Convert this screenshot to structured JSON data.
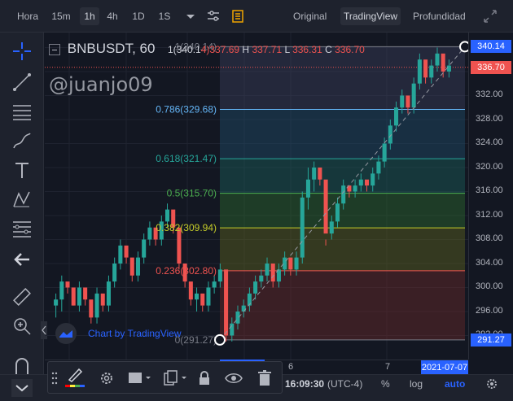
{
  "toolbar": {
    "timeframes": [
      {
        "label": "Hora",
        "active": false
      },
      {
        "label": "15m",
        "active": false
      },
      {
        "label": "1h",
        "active": true
      },
      {
        "label": "4h",
        "active": false
      },
      {
        "label": "1D",
        "active": false
      },
      {
        "label": "1S",
        "active": false
      }
    ],
    "chart_modes": [
      {
        "label": "Original",
        "active": false
      },
      {
        "label": "TradingView",
        "active": true
      },
      {
        "label": "Profundidad",
        "active": false
      }
    ],
    "icons": [
      "chevron-down-icon",
      "indicators-icon",
      "notes-icon",
      "fullscreen-icon"
    ]
  },
  "legend": {
    "symbol": "BNBUSDT, 60",
    "open_label": "1(340.1",
    "open_value": "4)",
    "open_extra": "337.69",
    "high_label": "H",
    "high_value": "337.71",
    "low_label": "L",
    "low_value": "336.31",
    "close_label": "C",
    "close_value": "336.70"
  },
  "watermark": "@juanjo09",
  "branding": "Chart by TradingView",
  "fib_levels": [
    {
      "label": "1(340.14)",
      "ratio": 1,
      "price": 340.14,
      "color": "#787b86"
    },
    {
      "label": "0.786(329.68)",
      "ratio": 0.786,
      "price": 329.68,
      "color": "#64b5f6"
    },
    {
      "label": "0.618(321.47)",
      "ratio": 0.618,
      "price": 321.47,
      "color": "#26a69a"
    },
    {
      "label": "0.5(315.70)",
      "ratio": 0.5,
      "price": 315.7,
      "color": "#4caf50"
    },
    {
      "label": "0.382(309.94)",
      "ratio": 0.382,
      "price": 309.94,
      "color": "#c5cc29"
    },
    {
      "label": "0.236(302.80)",
      "ratio": 0.236,
      "price": 302.8,
      "color": "#ef5350"
    },
    {
      "label": "0(291.27)",
      "ratio": 0,
      "price": 291.27,
      "color": "#787b86"
    }
  ],
  "price_axis": {
    "ticks": [
      "332.00",
      "328.00",
      "324.00",
      "320.00",
      "316.00",
      "312.00",
      "308.00",
      "304.00",
      "300.00",
      "296.00",
      "292.00"
    ],
    "top_badge": "340.14",
    "current_badge": "336.70",
    "bottom_badge": "291.27",
    "badge_color": "#2962ff",
    "current_color": "#ef5350"
  },
  "time_axis": {
    "ticks": [
      "6",
      "7"
    ],
    "date_badge": "2021-07-07"
  },
  "bottom": {
    "time": "16:09:30",
    "tz": "(UTC-4)",
    "percent": "%",
    "log": "log",
    "auto": "auto"
  },
  "drawing_panel": {
    "icons": [
      "brush-icon",
      "settings-icon",
      "fill-color-icon",
      "clone-icon",
      "lock-icon",
      "eye-icon",
      "trash-icon"
    ],
    "brush_colors": [
      "#ff0000",
      "#ffeb3b",
      "#4caf50",
      "#2962ff"
    ]
  },
  "left_toolbar": {
    "icons": [
      "crosshair-icon",
      "trend-line-icon",
      "horizontal-lines-icon",
      "brush-draw-icon",
      "text-icon",
      "pattern-icon",
      "fib-icon",
      "back-arrow-icon",
      "ruler-icon",
      "zoom-in-icon",
      "magnet-icon",
      "collapse-arrow-icon"
    ]
  },
  "chart_data": {
    "type": "candlestick",
    "symbol": "BNBUSDT, 60",
    "ylim": [
      288,
      342.5
    ],
    "x_ticks": [
      "6",
      "7"
    ],
    "candles": [
      [
        297,
        299,
        295,
        298
      ],
      [
        298,
        302,
        296,
        301
      ],
      [
        301,
        300,
        299,
        300
      ],
      [
        300,
        298,
        297,
        297
      ],
      [
        297,
        301,
        296,
        300
      ],
      [
        300,
        299,
        297,
        298
      ],
      [
        298,
        296,
        294,
        295
      ],
      [
        295,
        300,
        294,
        299
      ],
      [
        299,
        297,
        296,
        297
      ],
      [
        297,
        302,
        296,
        301
      ],
      [
        301,
        305,
        300,
        304
      ],
      [
        304,
        308,
        303,
        307
      ],
      [
        307,
        305,
        304,
        305
      ],
      [
        305,
        303,
        301,
        302
      ],
      [
        302,
        306,
        301,
        305
      ],
      [
        305,
        309,
        304,
        308
      ],
      [
        308,
        311,
        307,
        310
      ],
      [
        310,
        309,
        307,
        308
      ],
      [
        308,
        312,
        307,
        311
      ],
      [
        311,
        314,
        310,
        313
      ],
      [
        313,
        311,
        309,
        310
      ],
      [
        310,
        305,
        303,
        304
      ],
      [
        304,
        302,
        300,
        301
      ],
      [
        301,
        299,
        297,
        298
      ],
      [
        298,
        300,
        296,
        299
      ],
      [
        299,
        297,
        296,
        297
      ],
      [
        297,
        301,
        296,
        300
      ],
      [
        300,
        302,
        299,
        301
      ],
      [
        301,
        304,
        300,
        303
      ],
      [
        303,
        297,
        291,
        292
      ],
      [
        292,
        295,
        291,
        294
      ],
      [
        294,
        297,
        293,
        296
      ],
      [
        296,
        298,
        295,
        297
      ],
      [
        297,
        300,
        296,
        299
      ],
      [
        299,
        302,
        298,
        301
      ],
      [
        301,
        303,
        300,
        302
      ],
      [
        302,
        305,
        301,
        304
      ],
      [
        304,
        301,
        300,
        301
      ],
      [
        301,
        304,
        300,
        303
      ],
      [
        303,
        306,
        302,
        305
      ],
      [
        305,
        303,
        302,
        303
      ],
      [
        303,
        306,
        302,
        305
      ],
      [
        305,
        316,
        304,
        315
      ],
      [
        315,
        320,
        313,
        318
      ],
      [
        318,
        321,
        316,
        320
      ],
      [
        320,
        319,
        317,
        318
      ],
      [
        318,
        308,
        307,
        309
      ],
      [
        309,
        312,
        308,
        311
      ],
      [
        311,
        315,
        310,
        314
      ],
      [
        314,
        318,
        313,
        317
      ],
      [
        317,
        316,
        315,
        316
      ],
      [
        316,
        318,
        315,
        317
      ],
      [
        317,
        319,
        316,
        318
      ],
      [
        318,
        317,
        316,
        317
      ],
      [
        317,
        320,
        316,
        319
      ],
      [
        319,
        322,
        318,
        321
      ],
      [
        321,
        325,
        320,
        324
      ],
      [
        324,
        328,
        323,
        327
      ],
      [
        327,
        331,
        326,
        330
      ],
      [
        330,
        333,
        329,
        332
      ],
      [
        332,
        330,
        329,
        330
      ],
      [
        330,
        335,
        329,
        334
      ],
      [
        334,
        339,
        333,
        338
      ],
      [
        338,
        336,
        334,
        335
      ],
      [
        335,
        338,
        334,
        337
      ],
      [
        337,
        340,
        336,
        339
      ],
      [
        339,
        337,
        335,
        336
      ],
      [
        336,
        338,
        335,
        337
      ]
    ],
    "fib_retracement": {
      "from": 291.27,
      "to": 340.14
    }
  }
}
